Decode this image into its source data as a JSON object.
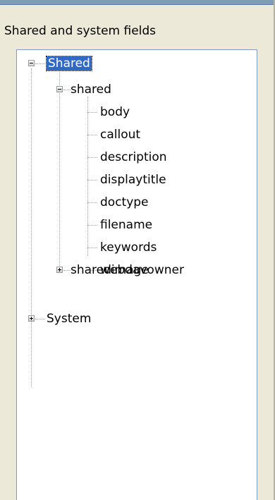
{
  "panel": {
    "label": "Shared and system fields"
  },
  "tree": {
    "shared_root": "Shared",
    "shared_group": "shared",
    "fields": [
      "body",
      "callout",
      "description",
      "displaytitle",
      "doctype",
      "filename",
      "keywords",
      "webdavowner"
    ],
    "sharedimage": "sharedimage",
    "system": "System"
  },
  "colors": {
    "selection": "#316ac5",
    "window_bg": "#ece9d8",
    "border": "#7f9db9"
  }
}
